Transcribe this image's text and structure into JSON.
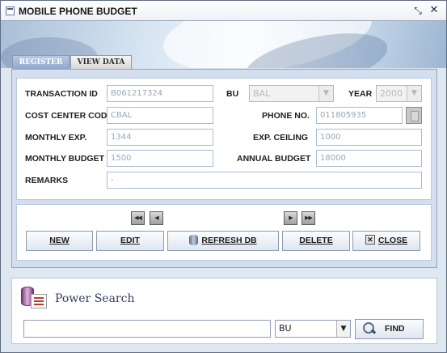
{
  "window": {
    "title": "MOBILE PHONE BUDGET",
    "restore_glyph": "⤡",
    "close_glyph": "✕"
  },
  "tabs": [
    {
      "label": "REGISTER",
      "active": true
    },
    {
      "label": "VIEW DATA",
      "active": false
    }
  ],
  "form": {
    "transaction_id": {
      "label": "TRANSACTION ID",
      "value": "B061217324"
    },
    "bu": {
      "label": "BU",
      "value": "BAL"
    },
    "year": {
      "label": "YEAR",
      "value": "2000"
    },
    "cost_center_code": {
      "label": "COST CENTER CODE",
      "value": "CBAL"
    },
    "phone_no": {
      "label": "PHONE NO.",
      "value": "011805935"
    },
    "monthly_exp": {
      "label": "MONTHLY EXP.",
      "value": "1344"
    },
    "exp_ceiling": {
      "label": "EXP. CEILING",
      "value": "1000"
    },
    "monthly_budget": {
      "label": "MONTHLY BUDGET",
      "value": "1500"
    },
    "annual_budget": {
      "label": "ANNUAL BUDGET",
      "value": "18000"
    },
    "remarks": {
      "label": "REMARKS",
      "value": "-"
    }
  },
  "navigation": {
    "first_glyph": "◀◀",
    "prev_glyph": "◀",
    "next_glyph": "▶",
    "last_glyph": "▶▶"
  },
  "actions": {
    "new": "NEW",
    "edit": "EDIT",
    "refresh_db": "REFRESH DB",
    "delete": "DELETE",
    "close": "CLOSE",
    "close_icon_glyph": "✕"
  },
  "power_search": {
    "title": "Power Search",
    "query_value": "",
    "filter_value": "BU",
    "find_label": "FIND"
  },
  "colors": {
    "accent": "#2f3c62",
    "panel": "#d3dfee",
    "field_text": "#9aa7b8"
  },
  "icons": [
    "window-icon",
    "restore-icon",
    "close-icon",
    "first-record-icon",
    "previous-record-icon",
    "next-record-icon",
    "last-record-icon",
    "database-icon",
    "close-x-icon",
    "power-search-icon",
    "magnifier-icon",
    "phone-lookup-icon",
    "dropdown-arrow-icon"
  ]
}
